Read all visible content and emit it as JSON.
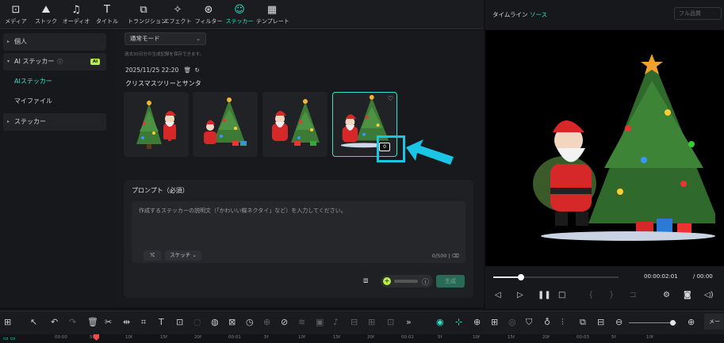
{
  "toolbar": {
    "items": [
      {
        "label": "メディア",
        "icon": "media-icon"
      },
      {
        "label": "ストック",
        "icon": "stock-icon"
      },
      {
        "label": "オーディオ",
        "icon": "music-note-icon"
      },
      {
        "label": "タイトル",
        "icon": "title-t-icon"
      },
      {
        "label": "トランジション",
        "icon": "transition-icon"
      },
      {
        "label": "エフェクト",
        "icon": "effect-sparkle-icon"
      },
      {
        "label": "フィルター",
        "icon": "filter-icon"
      },
      {
        "label": "ステッカー",
        "icon": "sticker-icon"
      },
      {
        "label": "テンプレート",
        "icon": "template-icon"
      }
    ],
    "active": "ステッカー"
  },
  "sidebar": {
    "items": [
      {
        "label": "個人"
      },
      {
        "label": "AI ステッカー",
        "badge": "AI"
      },
      {
        "label": "AIステッカー"
      },
      {
        "label": "マイファイル"
      },
      {
        "label": "ステッカー"
      }
    ]
  },
  "content": {
    "mode": "通常モード",
    "history_note": "過去30日分の生成記録を保存できます。",
    "date": "2025/11/25 22:20",
    "theme": "クリスマスツリーとサンタ",
    "thumbnails": [
      {
        "name": "santa-tree-1"
      },
      {
        "name": "santa-tree-2"
      },
      {
        "name": "santa-tree-3"
      },
      {
        "name": "santa-tree-4",
        "selected": true,
        "badge": "0"
      }
    ],
    "prompt": {
      "title": "プロンプト（必須）",
      "placeholder": "作成するステッカーの説明文（「かわいい蝶ネクタイ」など）を入力してください。",
      "style_label": "スケッチ",
      "count": "0/500"
    },
    "generate_label": "生成"
  },
  "preview": {
    "timeline_tab": "タイムライン",
    "source_tab": "ソース",
    "quality": "フル品質",
    "current_time": "00:00:02:01",
    "total_time": "/ 00:00"
  },
  "timeline": {
    "more_label": "メータ",
    "ruler": [
      "00:00",
      "5f",
      "10f",
      "15f",
      "20f",
      "00:01",
      "5f",
      "10f",
      "15f",
      "20f",
      "00:02",
      "5f",
      "10f",
      "15f",
      "20f",
      "00:03",
      "5f",
      "10f"
    ]
  },
  "colors": {
    "accent": "#2ee6c8",
    "highlight": "#19c6e6",
    "ai_badge": "#b8f04a"
  }
}
